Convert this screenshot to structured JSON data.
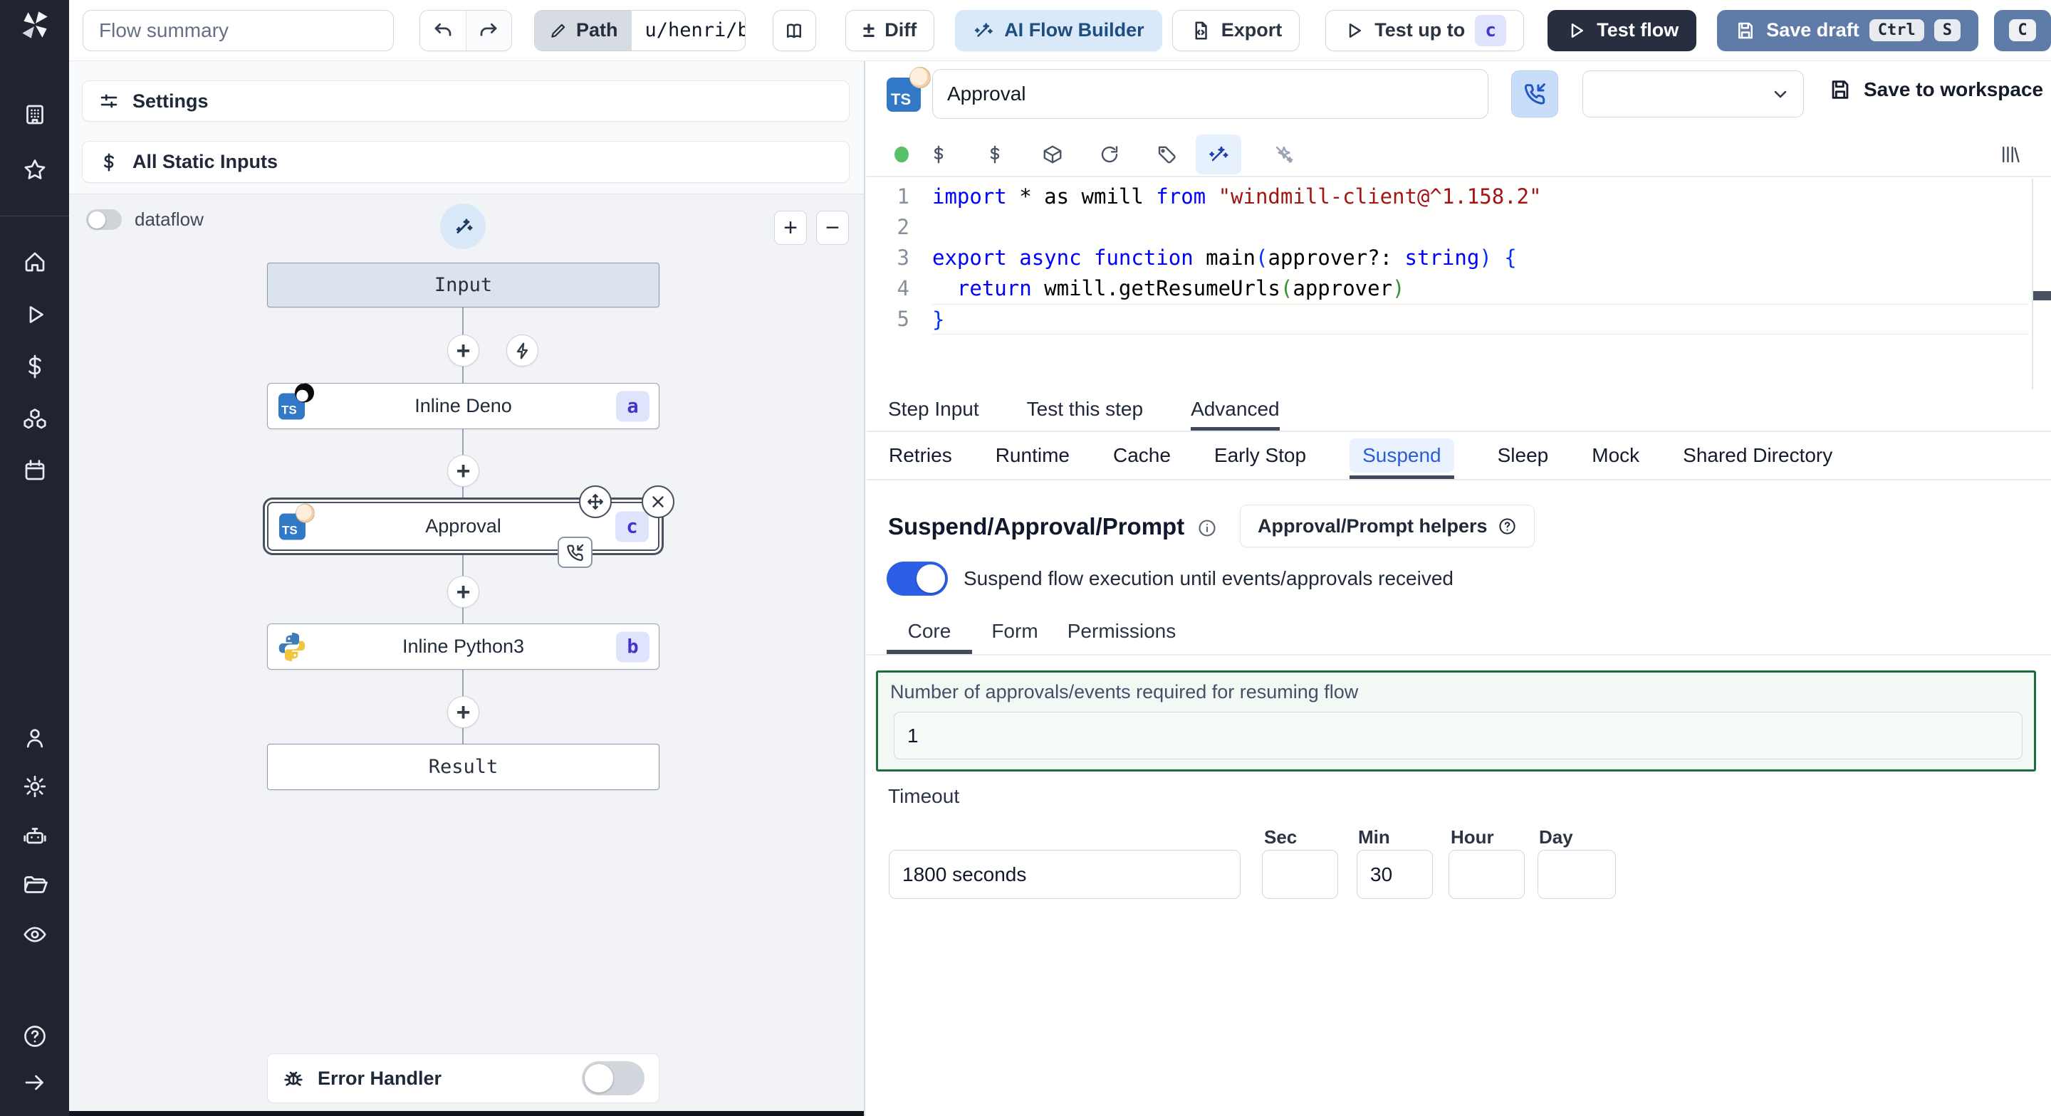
{
  "topbar": {
    "flow_summary_placeholder": "Flow summary",
    "path_label": "Path",
    "path_value": "u/henri/bes",
    "diff_symbol": "±",
    "diff_label": "Diff",
    "ai_flow_builder_label": "AI Flow Builder",
    "export_label": "Export",
    "test_up_to_label": "Test up to",
    "test_up_to_badge": "c",
    "test_flow_label": "Test flow",
    "save_draft_label": "Save draft",
    "kbd_ctrl": "Ctrl",
    "kbd_s": "S"
  },
  "sidebar": {
    "icons": [
      "windmill-logo",
      "workspace",
      "favorites",
      "home",
      "runs",
      "variables",
      "resources",
      "schedules",
      "user",
      "settings",
      "workers",
      "folders",
      "audit",
      "help",
      "expand"
    ]
  },
  "left_panel": {
    "settings_label": "Settings",
    "all_static_inputs_label": "All Static Inputs",
    "dataflow_label": "dataflow",
    "zoom_in_label": "+",
    "zoom_out_label": "−",
    "error_handler_label": "Error Handler"
  },
  "graph": {
    "nodes": [
      {
        "label": "Input"
      },
      {
        "label": "Inline Deno",
        "badge": "a",
        "language": "deno"
      },
      {
        "label": "Approval",
        "badge": "c",
        "language": "deno",
        "selected": true
      },
      {
        "label": "Inline Python3",
        "badge": "b",
        "language": "python3"
      },
      {
        "label": "Result"
      }
    ]
  },
  "step": {
    "name_value": "Approval",
    "save_to_workspace_label": "Save to workspace"
  },
  "code": {
    "language": "typescript",
    "lines": [
      [
        [
          "import",
          "kw"
        ],
        [
          " * as wmill ",
          "tx"
        ],
        [
          "from",
          "kw"
        ],
        [
          " ",
          "tx"
        ],
        [
          "\"windmill-client@^1.158.2\"",
          "str"
        ]
      ],
      [],
      [
        [
          "export",
          "kw"
        ],
        [
          " ",
          "tx"
        ],
        [
          "async",
          "kw"
        ],
        [
          " ",
          "tx"
        ],
        [
          "function",
          "kw"
        ],
        [
          " main",
          "tx"
        ],
        [
          "(",
          "b1"
        ],
        [
          "approver?: ",
          "tx"
        ],
        [
          "string",
          "kw"
        ],
        [
          ")",
          "b1"
        ],
        [
          " {",
          "b1"
        ]
      ],
      [
        [
          "  ",
          "tx"
        ],
        [
          "return",
          "kw"
        ],
        [
          " wmill.getResumeUrls",
          "tx"
        ],
        [
          "(",
          "b2"
        ],
        [
          "approver",
          "tx"
        ],
        [
          ")",
          "b2"
        ]
      ],
      [
        [
          "}",
          "b1"
        ]
      ]
    ]
  },
  "tabs": {
    "main": [
      "Step Input",
      "Test this step",
      "Advanced"
    ],
    "main_active": "Advanced",
    "advanced": [
      "Retries",
      "Runtime",
      "Cache",
      "Early Stop",
      "Suspend",
      "Sleep",
      "Mock",
      "Shared Directory"
    ],
    "advanced_active": "Suspend"
  },
  "suspend": {
    "heading": "Suspend/Approval/Prompt",
    "helpers_button_label": "Approval/Prompt helpers",
    "toggle_label": "Suspend flow execution until events/approvals received",
    "toggle_on": true,
    "tabs": [
      "Core",
      "Form",
      "Permissions"
    ],
    "tabs_active": "Core",
    "approvals_label": "Number of approvals/events required for resuming flow",
    "approvals_value": "1",
    "timeout_label": "Timeout",
    "timeout_value": "1800 seconds",
    "unit_labels": [
      "Sec",
      "Min",
      "Hour",
      "Day"
    ],
    "sec_value": "",
    "min_value": "30",
    "hour_value": "",
    "day_value": ""
  },
  "colors": {
    "sidebar_bg": "#1f2430",
    "accent_blue": "#2d5ee6",
    "ts_brand": "#3178c6",
    "badge_bg": "#dfe4fc",
    "badge_text": "#4633c9",
    "green_border": "#1b6f3d",
    "save_draft_bg": "#5f7ca8",
    "dark_button_bg": "#272e3f",
    "status_dot": "#56c16a"
  }
}
